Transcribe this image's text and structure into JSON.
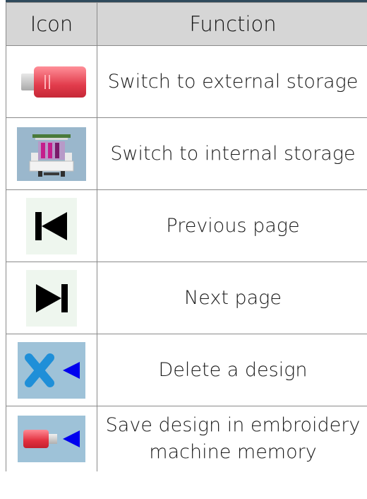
{
  "table": {
    "headers": {
      "icon": "Icon",
      "function": "Function"
    },
    "rows": [
      {
        "icon": "usb-drive-icon",
        "function": "Switch to external storage"
      },
      {
        "icon": "embroidery-machine-icon",
        "function": "Switch to internal storage"
      },
      {
        "icon": "previous-page-icon",
        "function": "Previous page"
      },
      {
        "icon": "next-page-icon",
        "function": "Next page"
      },
      {
        "icon": "delete-design-icon",
        "function": "Delete a design"
      },
      {
        "icon": "save-to-machine-icon",
        "function": "Save design in embroidery machine memory"
      }
    ]
  },
  "colors": {
    "header_bg": "#d6d6d6",
    "usb_red": "#e23c4c",
    "icon_bg_blue": "#9ec2d8",
    "delete_x": "#1f8fd8",
    "arrow_blue": "#0000ee"
  }
}
